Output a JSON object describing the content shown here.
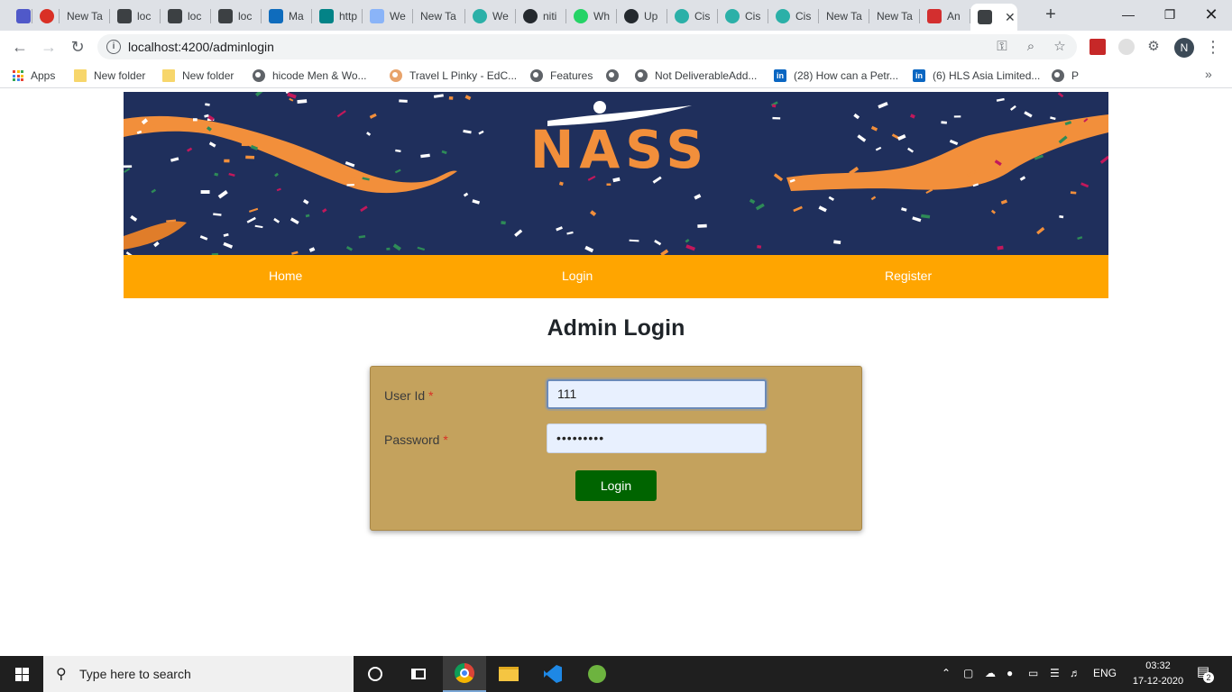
{
  "browser": {
    "tabs": [
      {
        "label": "",
        "icon": "teams-icon"
      },
      {
        "label": "",
        "icon": "record-icon"
      },
      {
        "label": "New Ta",
        "icon": ""
      },
      {
        "label": "loc",
        "icon": "angular-icon"
      },
      {
        "label": "loc",
        "icon": "angular-icon"
      },
      {
        "label": "loc",
        "icon": "angular-icon"
      },
      {
        "label": "Ma",
        "icon": "outlook-icon"
      },
      {
        "label": "http",
        "icon": "sharepoint-icon"
      },
      {
        "label": "We",
        "icon": "document-icon"
      },
      {
        "label": "New Ta",
        "icon": ""
      },
      {
        "label": "We",
        "icon": "edge-icon"
      },
      {
        "label": "niti",
        "icon": "github-icon"
      },
      {
        "label": "Wh",
        "icon": "whatsapp-icon"
      },
      {
        "label": "Up",
        "icon": "github-icon"
      },
      {
        "label": "Cis",
        "icon": "edge-icon"
      },
      {
        "label": "Cis",
        "icon": "edge-icon"
      },
      {
        "label": "Cis",
        "icon": "edge-icon"
      },
      {
        "label": "New Ta",
        "icon": ""
      },
      {
        "label": "New Ta",
        "icon": ""
      },
      {
        "label": "An",
        "icon": "vercel-icon"
      },
      {
        "label": "",
        "icon": "angular-icon",
        "active": true
      }
    ],
    "url": "localhost:4200/adminlogin",
    "profile_initial": "N",
    "bookmarks": [
      {
        "label": "Apps",
        "icon": "apps-grid-icon"
      },
      {
        "label": "New folder",
        "icon": "folder-icon"
      },
      {
        "label": "New folder",
        "icon": "folder-icon"
      },
      {
        "label": "hicode Men & Wo...",
        "icon": "globe-icon"
      },
      {
        "label": "Travel L Pinky - EdC...",
        "icon": "avatar-icon"
      },
      {
        "label": "Features",
        "icon": "globe-icon"
      },
      {
        "label": "",
        "icon": "globe-icon"
      },
      {
        "label": "Not DeliverableAdd...",
        "icon": "globe-icon"
      },
      {
        "label": "(28) How can a Petr...",
        "icon": "linkedin-icon"
      },
      {
        "label": "(6) HLS Asia Limited...",
        "icon": "linkedin-icon"
      },
      {
        "label": "P",
        "icon": "globe-icon"
      }
    ]
  },
  "site": {
    "logo_text": "NASS",
    "nav": {
      "home": "Home",
      "login": "Login",
      "register": "Register"
    },
    "page_title": "Admin Login",
    "form": {
      "userid_label": "User Id",
      "userid_value": "111",
      "password_label": "Password",
      "password_value": "•••••••••",
      "required_mark": "*",
      "submit_label": "Login"
    }
  },
  "taskbar": {
    "search_placeholder": "Type here to search",
    "language": "ENG",
    "time": "03:32",
    "date": "17-12-2020",
    "notification_count": "2"
  },
  "colors": {
    "banner_bg": "#1f2f5c",
    "nav_bg": "#ffa500",
    "form_bg": "#c4a25d",
    "button_bg": "#006400",
    "logo_orange": "#f28f3b"
  }
}
